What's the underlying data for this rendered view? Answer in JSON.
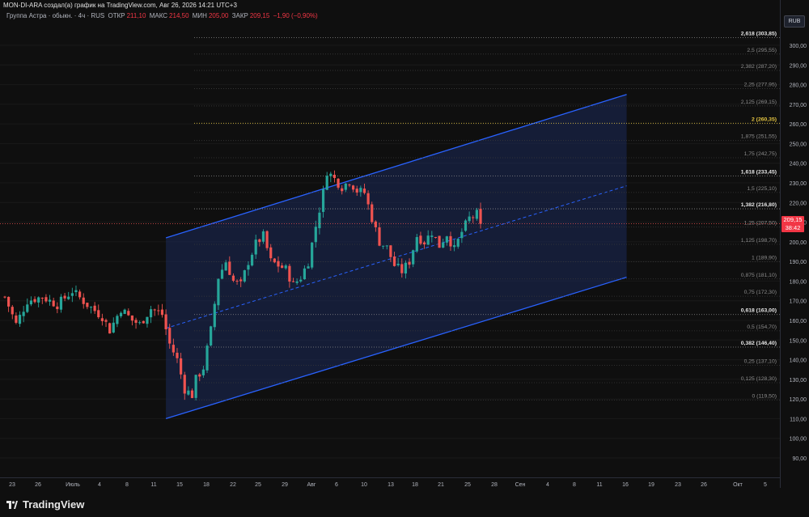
{
  "header": {
    "caption": "MON-DI-ARA создал(а) график на TradingView.com, Авг 26, 2026 14:21 UTC+3",
    "symbol": "Группа Астра · обыкн. · 4ч · RUS",
    "open_label": "ОТКР",
    "open_value": "211,10",
    "high_label": "МАКС",
    "high_value": "214,50",
    "low_label": "МИН",
    "low_value": "205,00",
    "close_label": "ЗАКР",
    "close_value": "209,15",
    "change": "−1,90 (−0,90%)"
  },
  "price_axis": {
    "currency": "RUB",
    "last_price": "209,15",
    "countdown": "38:42"
  },
  "footer": {
    "brand": "TradingView"
  },
  "colors": {
    "background": "#0f0f0f",
    "up": "#26a69a",
    "down": "#ef5350",
    "channel": "#2962ff",
    "channel_fill": "#1c2a5a",
    "fib_gold": "#e4c441"
  },
  "chart_data": {
    "type": "candlestick",
    "ylim": [
      85,
      310
    ],
    "y_ticks": [
      "300,00",
      "290,00",
      "280,00",
      "270,00",
      "260,00",
      "250,00",
      "240,00",
      "230,00",
      "220,00",
      "210,00",
      "200,00",
      "190,00",
      "180,00",
      "170,00",
      "160,00",
      "150,00",
      "140,00",
      "130,00",
      "120,00",
      "110,00",
      "100,00",
      "90,00"
    ],
    "x_ticks": [
      "23",
      "26",
      "Июль",
      "4",
      "8",
      "11",
      "15",
      "18",
      "22",
      "25",
      "29",
      "Авг",
      "6",
      "10",
      "13",
      "18",
      "21",
      "25",
      "28",
      "Сен",
      "4",
      "8",
      "11",
      "16",
      "19",
      "23",
      "26",
      "Окт",
      "5"
    ],
    "fib_levels": [
      {
        "ratio": "0",
        "price": 119.5,
        "label": "0 (119,50)",
        "style": "normal"
      },
      {
        "ratio": "0,125",
        "price": 128.3,
        "label": "0,125 (128,30)",
        "style": "normal"
      },
      {
        "ratio": "0,25",
        "price": 137.1,
        "label": "0,25 (137,10)",
        "style": "normal"
      },
      {
        "ratio": "0,382",
        "price": 146.4,
        "label": "0,382 (146,40)",
        "style": "bold"
      },
      {
        "ratio": "0,5",
        "price": 154.7,
        "label": "0,5 (154,70)",
        "style": "normal"
      },
      {
        "ratio": "0,618",
        "price": 163.0,
        "label": "0,618 (163,00)",
        "style": "bold"
      },
      {
        "ratio": "0,75",
        "price": 172.3,
        "label": "0,75 (172,30)",
        "style": "normal"
      },
      {
        "ratio": "0,875",
        "price": 181.1,
        "label": "0,875 (181,10)",
        "style": "normal"
      },
      {
        "ratio": "1",
        "price": 189.9,
        "label": "1 (189,90)",
        "style": "normal"
      },
      {
        "ratio": "1,125",
        "price": 198.7,
        "label": "1,125 (198,70)",
        "style": "normal"
      },
      {
        "ratio": "1,25",
        "price": 207.5,
        "label": "1,25 (207,50)",
        "style": "normal"
      },
      {
        "ratio": "1,382",
        "price": 216.8,
        "label": "1,382 (216,80)",
        "style": "bold"
      },
      {
        "ratio": "1,5",
        "price": 225.1,
        "label": "1,5 (225,10)",
        "style": "normal"
      },
      {
        "ratio": "1,618",
        "price": 233.45,
        "label": "1,618 (233,45)",
        "style": "bold"
      },
      {
        "ratio": "1,75",
        "price": 242.75,
        "label": "1,75 (242,75)",
        "style": "normal"
      },
      {
        "ratio": "1,875",
        "price": 251.55,
        "label": "1,875 (251,55)",
        "style": "normal"
      },
      {
        "ratio": "2",
        "price": 260.35,
        "label": "2 (260,35)",
        "style": "gold"
      },
      {
        "ratio": "2,125",
        "price": 269.15,
        "label": "2,125 (269,15)",
        "style": "normal"
      },
      {
        "ratio": "2,25",
        "price": 277.95,
        "label": "2,25 (277,95)",
        "style": "normal"
      },
      {
        "ratio": "2,382",
        "price": 287.2,
        "label": "2,382 (287,20)",
        "style": "normal"
      },
      {
        "ratio": "2,5",
        "price": 295.55,
        "label": "2,5 (295,55)",
        "style": "normal"
      },
      {
        "ratio": "2,618",
        "price": 303.85,
        "label": "2,618 (303,85)",
        "style": "bold"
      }
    ],
    "last_close": 209.15,
    "price_path": [
      [
        0,
        172
      ],
      [
        3,
        158
      ],
      [
        6,
        170
      ],
      [
        10,
        172
      ],
      [
        14,
        168
      ],
      [
        18,
        175
      ],
      [
        22,
        168
      ],
      [
        26,
        162
      ],
      [
        28,
        155
      ],
      [
        31,
        166
      ],
      [
        34,
        160
      ],
      [
        36,
        158
      ],
      [
        39,
        166
      ],
      [
        42,
        163
      ],
      [
        44,
        148
      ],
      [
        46,
        140
      ],
      [
        48,
        125
      ],
      [
        50,
        122
      ],
      [
        51,
        130
      ],
      [
        53,
        136
      ],
      [
        55,
        155
      ],
      [
        57,
        182
      ],
      [
        59,
        190
      ],
      [
        61,
        180
      ],
      [
        63,
        178
      ],
      [
        65,
        190
      ],
      [
        67,
        199
      ],
      [
        69,
        203
      ],
      [
        71,
        190
      ],
      [
        73,
        188
      ],
      [
        75,
        186
      ],
      [
        77,
        178
      ],
      [
        79,
        182
      ],
      [
        81,
        190
      ],
      [
        83,
        208
      ],
      [
        85,
        225
      ],
      [
        86,
        236
      ],
      [
        88,
        232
      ],
      [
        90,
        228
      ],
      [
        92,
        231
      ],
      [
        94,
        226
      ],
      [
        96,
        225
      ],
      [
        98,
        212
      ],
      [
        100,
        200
      ],
      [
        102,
        197
      ],
      [
        104,
        188
      ],
      [
        106,
        185
      ],
      [
        108,
        190
      ],
      [
        110,
        203
      ],
      [
        112,
        200
      ],
      [
        114,
        205
      ],
      [
        116,
        198
      ],
      [
        118,
        204
      ],
      [
        120,
        196
      ],
      [
        122,
        205
      ],
      [
        124,
        212
      ],
      [
        126,
        214
      ],
      [
        127,
        209
      ]
    ],
    "candle_count": 128,
    "channel": {
      "start_bar": 43,
      "end_bar": 166,
      "upper_start": 202,
      "upper_end": 275,
      "lower_start": 110,
      "lower_end": 182
    }
  }
}
